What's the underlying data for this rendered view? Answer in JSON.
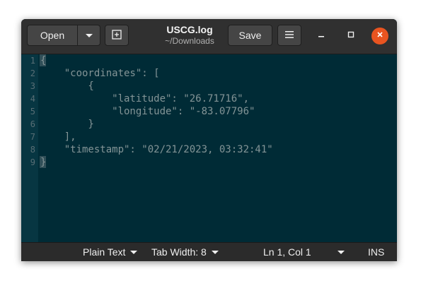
{
  "header": {
    "open_label": "Open",
    "save_label": "Save",
    "title": "USCG.log",
    "subtitle": "~/Downloads",
    "icons": {
      "open_menu": "chevron-down-icon",
      "new_tab": "new-tab-icon",
      "menu": "hamburger-menu-icon",
      "minimize": "minimize-icon",
      "maximize": "maximize-icon",
      "close": "close-icon"
    }
  },
  "editor": {
    "lines": [
      {
        "num": "1",
        "text": "{"
      },
      {
        "num": "2",
        "text": "    \"coordinates\": ["
      },
      {
        "num": "3",
        "text": "        {"
      },
      {
        "num": "4",
        "text": "            \"latitude\": \"26.71716\","
      },
      {
        "num": "5",
        "text": "            \"longitude\": \"-83.07796\""
      },
      {
        "num": "6",
        "text": "        }"
      },
      {
        "num": "7",
        "text": "    ],"
      },
      {
        "num": "8",
        "text": "    \"timestamp\": \"02/21/2023, 03:32:41\""
      },
      {
        "num": "9",
        "text": "}"
      }
    ]
  },
  "status": {
    "language": "Plain Text",
    "tab_width": "Tab Width: 8",
    "position": "Ln 1, Col 1",
    "mode": "INS"
  },
  "colors": {
    "background": "#002b36",
    "text": "#839496",
    "close_button": "#e95420"
  }
}
